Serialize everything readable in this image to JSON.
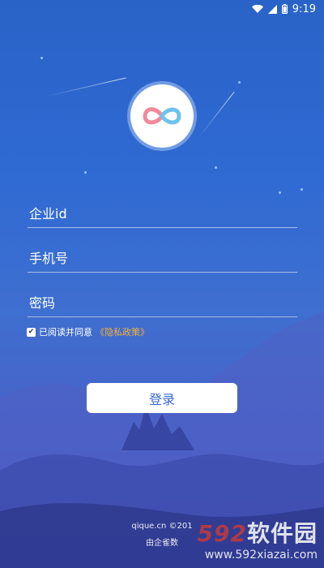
{
  "status_bar": {
    "time": "9:19",
    "icons": [
      "wifi-icon",
      "signal-icon",
      "battery-icon"
    ]
  },
  "logo": {
    "icon": "infinity-logo-icon",
    "colors": [
      "#f08a9a",
      "#6fc3ea"
    ]
  },
  "form": {
    "company_id_placeholder": "企业id",
    "phone_placeholder": "手机号",
    "password_placeholder": "密码"
  },
  "agreement": {
    "checked": true,
    "text": "已阅读并同意",
    "policy_link": "《隐私政策》"
  },
  "login_button": "登录",
  "footer": {
    "line1": "qique.cn ©201",
    "line2": "由企雀数"
  },
  "watermark": {
    "number": "592",
    "brand": "软件园",
    "url": "www.592xiazai.com"
  },
  "colors": {
    "background_top": "#2a63c7",
    "background_bottom": "#3b4aa8",
    "policy_link": "#f3b23a",
    "button_text": "#3a6bd6"
  }
}
